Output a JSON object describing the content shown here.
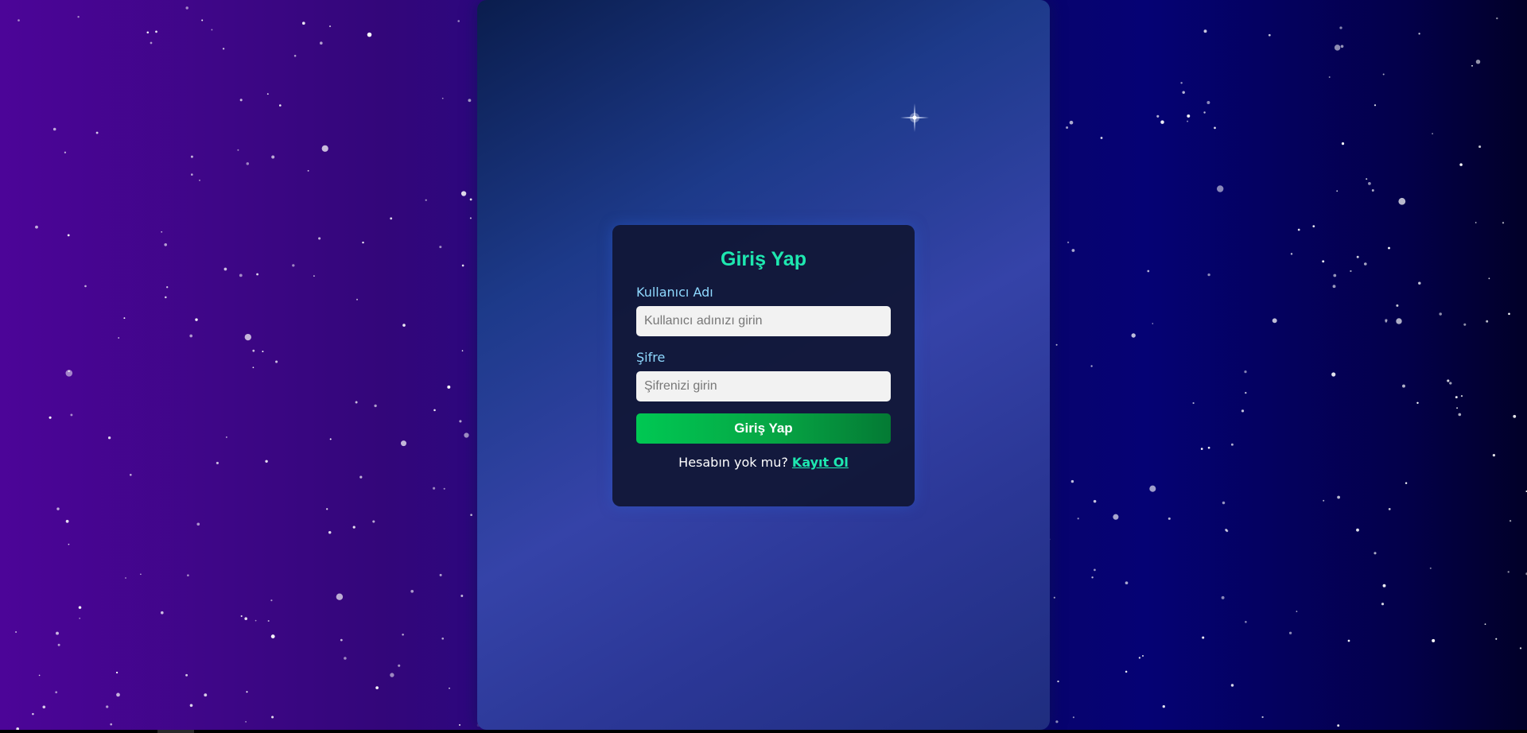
{
  "login": {
    "title": "Giriş Yap",
    "username_label": "Kullanıcı Adı",
    "username_placeholder": "Kullanıcı adınızı girin",
    "username_value": "",
    "password_label": "Şifre",
    "password_placeholder": "Şifrenizi girin",
    "password_value": "",
    "submit_label": "Giriş Yap",
    "no_account_text": "Hesabın yok mu?",
    "register_link": "Kayıt Ol"
  },
  "colors": {
    "accent": "#1ee8b0",
    "label": "#8fd9ff",
    "button_start": "#00c853",
    "button_end": "#047a34",
    "card_bg": "#101634"
  }
}
